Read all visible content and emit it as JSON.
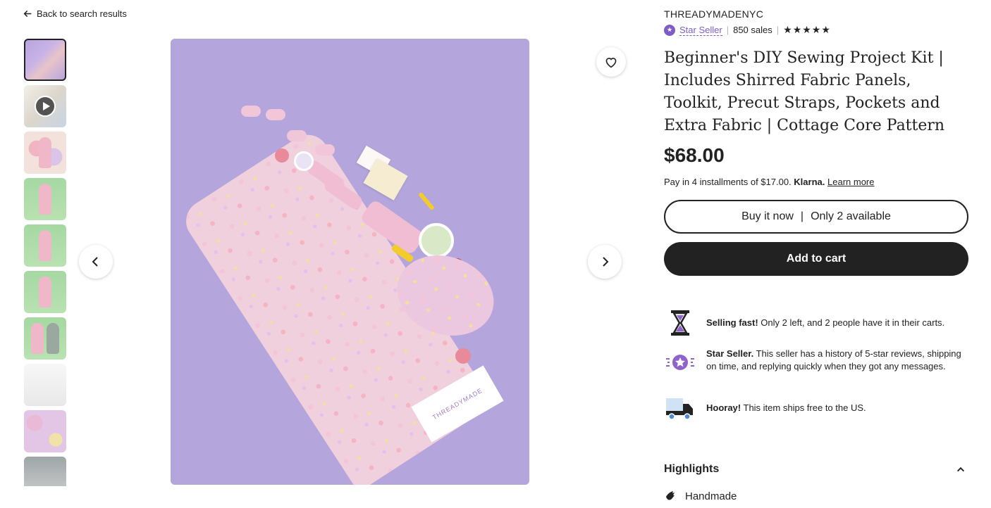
{
  "nav": {
    "back_label": "Back to search results"
  },
  "shop": {
    "name": "THREADYMADENYC",
    "star_seller_label": "Star Seller",
    "sales": "850 sales",
    "rating_stars": "★★★★★",
    "rating_value": 5
  },
  "listing": {
    "title": "Beginner's DIY Sewing Project Kit | Includes Shirred Fabric Panels, Toolkit, Precut Straps, Pockets and Extra Fabric | Cottage Core Pattern",
    "price": "$68.00",
    "klarna_text": "Pay in 4 installments of $17.00.",
    "klarna_brand": "Klarna.",
    "learn_more": "Learn more"
  },
  "actions": {
    "buy_now": "Buy it now",
    "separator": "|",
    "availability": "Only 2 available",
    "add_to_cart": "Add to cart"
  },
  "info": [
    {
      "icon": "hourglass-icon",
      "bold": "Selling fast!",
      "text": " Only 2 left, and 2 people have it in their carts."
    },
    {
      "icon": "star-seller-icon",
      "bold": "Star Seller.",
      "text": " This seller has a history of 5-star reviews, shipping on time, and replying quickly when they got any messages."
    },
    {
      "icon": "truck-icon",
      "bold": "Hooray!",
      "text": " This item ships free to the US."
    }
  ],
  "highlights": {
    "label": "Highlights",
    "items": [
      "Handmade"
    ]
  },
  "image_tag_text": "THREADYMADE",
  "colors": {
    "accent": "#7f5cc4",
    "text": "#222222",
    "image_bg": "#b4a6dc"
  }
}
